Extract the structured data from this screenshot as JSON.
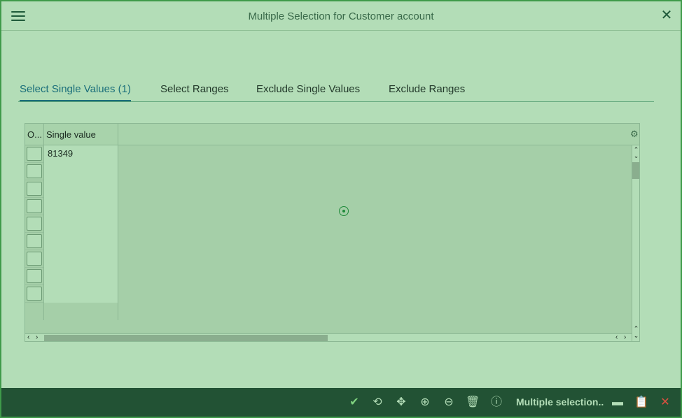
{
  "window": {
    "title": "Multiple Selection for Customer account"
  },
  "tabs": [
    {
      "label": "Select Single Values (1)",
      "active": true
    },
    {
      "label": "Select Ranges",
      "active": false
    },
    {
      "label": "Exclude Single Values",
      "active": false
    },
    {
      "label": "Exclude Ranges",
      "active": false
    }
  ],
  "table": {
    "columns": [
      "O...",
      "Single value"
    ],
    "rows": [
      {
        "value": "81349"
      },
      {
        "value": ""
      },
      {
        "value": ""
      },
      {
        "value": ""
      },
      {
        "value": ""
      },
      {
        "value": ""
      },
      {
        "value": ""
      },
      {
        "value": ""
      },
      {
        "value": ""
      }
    ]
  },
  "footer": {
    "multiple_selection_label": "Multiple selection..",
    "icons": [
      "check-icon",
      "clock-icon",
      "move-icon",
      "add-icon",
      "remove-icon",
      "delete-icon",
      "info-icon",
      "comment-icon",
      "clipboard-icon",
      "cancel-icon"
    ]
  },
  "colors": {
    "accent": "#1a6e7a",
    "footer_bg": "#225234",
    "window_bg": "#b3ddb7"
  }
}
